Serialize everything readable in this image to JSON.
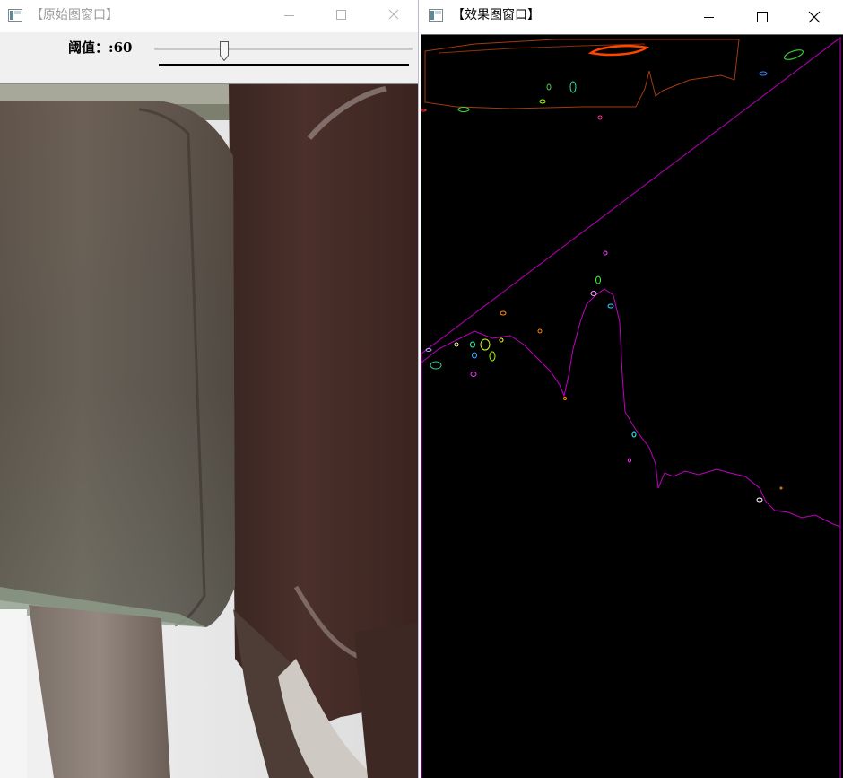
{
  "left_window": {
    "title": "【原始图窗口】",
    "trackbar": {
      "label": "阈值：",
      "value": "60",
      "fraction": 0.27
    }
  },
  "right_window": {
    "title": "【效果图窗口】"
  },
  "colors": {
    "contour_magenta": "#b000b0",
    "contour_orange": "#ff4400",
    "contour_green": "#33dd33",
    "canvas_bg": "#000000"
  },
  "icons": [
    "app-icon",
    "minimize-icon",
    "maximize-icon",
    "close-icon"
  ]
}
